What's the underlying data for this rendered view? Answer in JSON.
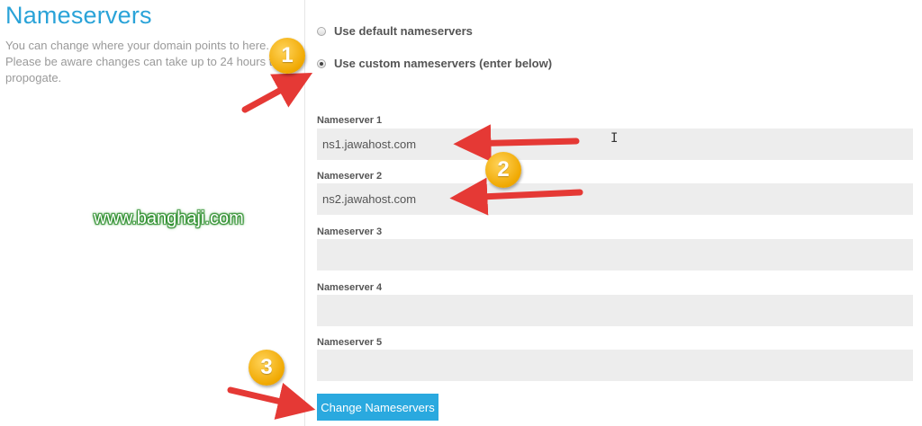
{
  "left": {
    "title": "Nameservers",
    "description": "You can change where your domain points to here. Please be aware changes can take up to 24 hours to propogate."
  },
  "options": [
    {
      "label": "Use default nameservers",
      "checked": false
    },
    {
      "label": "Use custom nameservers (enter below)",
      "checked": true
    }
  ],
  "nameservers": [
    {
      "label": "Nameserver 1",
      "value": "ns1.jawahost.com"
    },
    {
      "label": "Nameserver 2",
      "value": "ns2.jawahost.com"
    },
    {
      "label": "Nameserver 3",
      "value": ""
    },
    {
      "label": "Nameserver 4",
      "value": ""
    },
    {
      "label": "Nameserver 5",
      "value": ""
    }
  ],
  "submit_label": "Change Nameservers",
  "annotations": {
    "badges": [
      "1",
      "2",
      "3"
    ],
    "watermark": "www.banghaji.com",
    "badge_color": "#f0a800",
    "arrow_color": "#e53935"
  },
  "colors": {
    "accent": "#2aa9df",
    "title": "#2aa3d8",
    "input_bg": "#ededed"
  }
}
